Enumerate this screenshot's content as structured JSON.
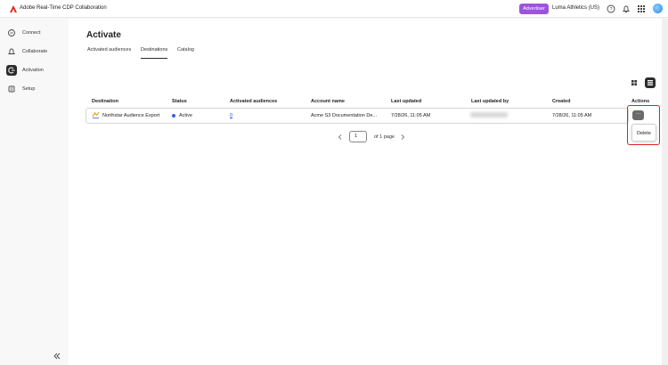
{
  "topbar": {
    "app_title": "Adobe Real-Time CDP Collaboration",
    "role_badge": "Advertiser",
    "org_name": "Luma Athletics (US)",
    "accent_color": "#9c54dc",
    "icons": [
      "help-icon",
      "bell-icon",
      "apps-grid-icon",
      "avatar"
    ]
  },
  "sidebar": {
    "items": [
      {
        "label": "Connect",
        "icon": "connect-icon"
      },
      {
        "label": "Collaborate",
        "icon": "bell-outline-icon"
      },
      {
        "label": "Activation",
        "icon": "activation-icon",
        "active": true
      },
      {
        "label": "Setup",
        "icon": "setup-icon"
      }
    ]
  },
  "main": {
    "title": "Activate",
    "tabs": [
      {
        "label": "Activated audiences"
      },
      {
        "label": "Destinations",
        "active": true
      },
      {
        "label": "Catalog"
      }
    ],
    "table": {
      "headers": [
        "Destination",
        "Status",
        "Activated audiences",
        "Account name",
        "Last updated",
        "Last updated by",
        "Created",
        "Actions"
      ],
      "rows": [
        {
          "destination": "Northstar Audience Export",
          "status": "Active",
          "activated_audiences": "0",
          "account_name": "Acme S3 Documentation De...",
          "last_updated": "7/28/26, 11:05 AM",
          "created": "7/28/26, 11:05 AM"
        }
      ]
    },
    "actions_button": "···",
    "actions_menu": {
      "delete_label": "Delete"
    },
    "pagination": {
      "page": "1",
      "of_text": "of 1 page"
    }
  },
  "colors": {
    "status_active": "#3a5fd9",
    "highlight": "#e02020",
    "link": "#1d4dd8"
  }
}
